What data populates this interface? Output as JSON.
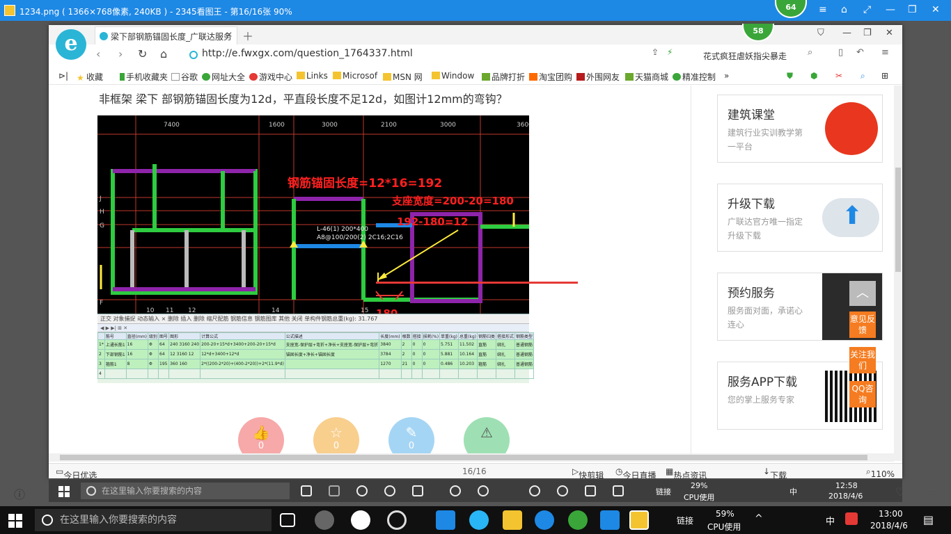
{
  "outer_window": {
    "title": "1234.png ( 1366×768像素, 240KB ) - 2345看图王 - 第16/16张 90%",
    "badge_top": "64"
  },
  "browser": {
    "tab_title": "梁下部钢筋锚固长度_广联达服务",
    "badge": "58",
    "url": "http://e.fwxgx.com/question_1764337.html",
    "search_hint": "花式疯狂虐妖指尖暴走",
    "bookmarks": [
      "收藏",
      "手机收藏夹",
      "谷歌",
      "网址大全",
      "游戏中心",
      "Links",
      "Microsof",
      "MSN 网",
      "Window",
      "品牌打折",
      "淘宝团购",
      "外围网友",
      "天猫商城",
      "精准控制"
    ]
  },
  "question": {
    "title": "非框架 梁下 部钢筋锚固长度为12d，平直段长度不足12d，如图计12mm的弯钩？"
  },
  "cad": {
    "top_dims": [
      "7400",
      "1600",
      "3000",
      "2100",
      "3000",
      "3600"
    ],
    "axis_labels": [
      "J",
      "H",
      "G",
      "F"
    ],
    "bottom_dims": [
      "10",
      "11",
      "12",
      "14",
      "15"
    ],
    "annot1": "钢筋锚固长度=12*16=192",
    "annot2": "支座宽度=200-20=180",
    "annot3": "192-180=12",
    "annot4": "180",
    "beam_label1": "L-46(1) 200*400",
    "beam_label2": "A8@100/200(2) 2C16;2C16",
    "sheet_toolbar": "正交 对象捕捉 动态输入 ×  删除 插入 删除 缩尺配筋 钢筋信息 钢筋图库 其他 关闭  单构件钢筋总重(kg): 31.767",
    "sheet_headers": [
      "筋号",
      "直径(mm)",
      "级别",
      "图号",
      "图形",
      "计算公式",
      "公式描述",
      "长度(mm)",
      "根数",
      "搭接",
      "损耗(%)",
      "单重(kg)",
      "总重(kg)",
      "钢筋归类",
      "搭接形式",
      "钢筋类型"
    ],
    "sheet_rows": [
      [
        "1*",
        "上通长筋1",
        "16",
        "Φ",
        "64",
        "240 3160 240",
        "200-20+15*d+3400+200-20+15*d",
        "支座宽-保护层+弯折+净长+支座宽-保护层+弯折",
        "3840",
        "2",
        "0",
        "0",
        "5.751",
        "11.502",
        "直筋",
        "绑扎",
        "普通钢筋"
      ],
      [
        "2",
        "下部钢筋1",
        "16",
        "Φ",
        "64",
        "12 3160 12",
        "12*d+3400+12*d",
        "锚固长度+净长+锚固长度",
        "3784",
        "2",
        "0",
        "0",
        "5.881",
        "10.164",
        "直筋",
        "绑扎",
        "普通钢筋"
      ],
      [
        "3",
        "箍筋1",
        "8",
        "Φ",
        "195",
        "360 160",
        "2*((200-2*20)+(400-2*20))+2*(11.9*d)",
        "",
        "1270",
        "21",
        "0",
        "0",
        "0.486",
        "10.203",
        "箍筋",
        "绑扎",
        "普通钢筋"
      ],
      [
        "4",
        "",
        "",
        "",
        "",
        "",
        "",
        "",
        "",
        "",
        "",
        "",
        "",
        "",
        "",
        ""
      ]
    ]
  },
  "actions": [
    {
      "icon": "👍",
      "count": "0",
      "color": "#f49a9a"
    },
    {
      "icon": "☆",
      "count": "0",
      "color": "#f8c37a"
    },
    {
      "icon": "✎",
      "count": "0",
      "color": "#8cc8f0"
    },
    {
      "icon": "⚠",
      "count": "",
      "color": "#7dd39a"
    }
  ],
  "sidebar": [
    {
      "title": "建筑课堂",
      "desc": "建筑行业实训教学第一平台"
    },
    {
      "title": "升级下载",
      "desc": "广联达官方唯一指定升级下载"
    },
    {
      "title": "预约服务",
      "desc": "服务面对面，承诺心连心"
    },
    {
      "title": "服务APP下载",
      "desc": "您的掌上服务专家"
    }
  ],
  "float_tabs": [
    "意见反馈",
    "关注我们",
    "QQ咨询"
  ],
  "status": {
    "left": "今日优选",
    "page": "16/16",
    "items": [
      "快剪辑",
      "今日直播",
      "热点资讯",
      "下载"
    ],
    "zoom": "110%"
  },
  "viewer_tb": {
    "search_placeholder": "在这里输入你要搜索的内容",
    "net": "链接",
    "cpu": "29%",
    "cpu_label": "CPU使用",
    "ime": "中",
    "time": "12:58",
    "date": "2018/4/6"
  },
  "taskbar": {
    "search_placeholder": "在这里输入你要搜索的内容",
    "net": "链接",
    "cpu": "59%",
    "cpu_label": "CPU使用",
    "ime": "中",
    "time": "13:00",
    "date": "2018/4/6"
  }
}
